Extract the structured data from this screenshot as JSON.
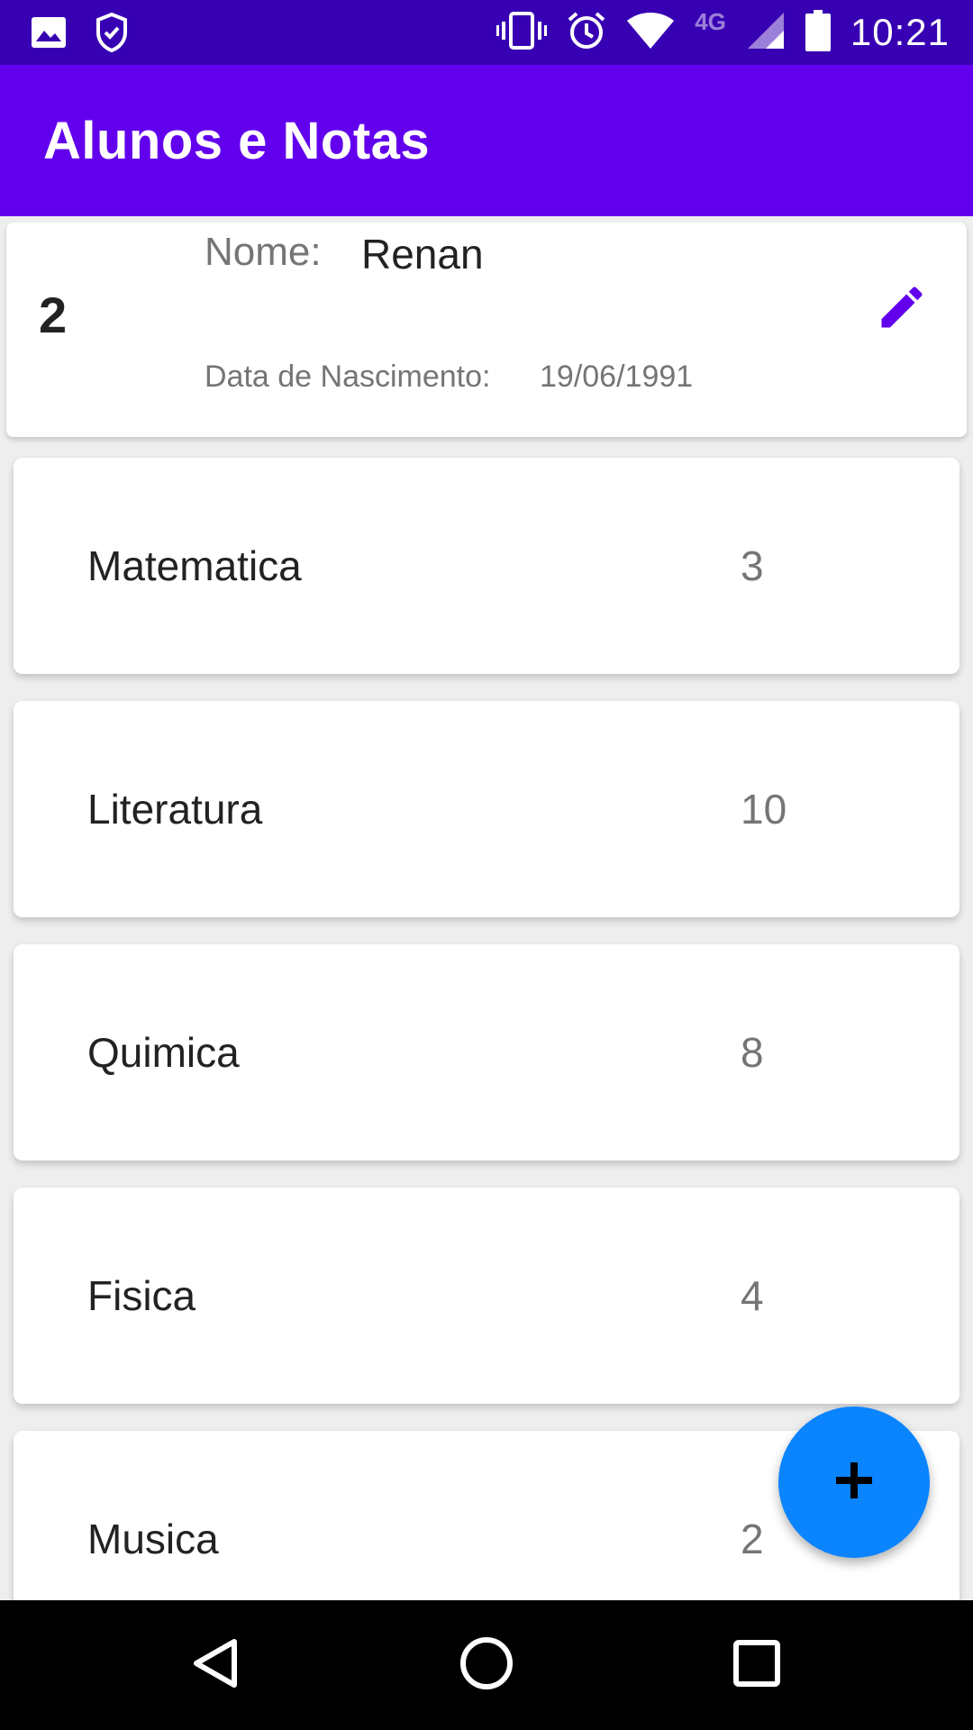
{
  "status_bar": {
    "time": "10:21",
    "network_label": "4G",
    "icons": [
      "image-icon",
      "shield-check-icon",
      "vibrate-icon",
      "alarm-icon",
      "wifi-icon",
      "signal-icon",
      "battery-icon"
    ]
  },
  "app_bar": {
    "title": "Alunos e Notas",
    "color": "#6200ee"
  },
  "student": {
    "id": "2",
    "name_label": "Nome:",
    "name": "Renan",
    "dob_label": "Data de Nascimento:",
    "dob": "19/06/1991",
    "edit_icon": "pencil-icon"
  },
  "grades": [
    {
      "subject": "Matematica",
      "grade": "3"
    },
    {
      "subject": "Literatura",
      "grade": "10"
    },
    {
      "subject": "Quimica",
      "grade": "8"
    },
    {
      "subject": "Fisica",
      "grade": "4"
    },
    {
      "subject": "Musica",
      "grade": "2"
    }
  ],
  "fab": {
    "icon": "plus-icon",
    "color": "#0a84ff"
  },
  "nav_bar": {
    "icons": [
      "back-icon",
      "home-icon",
      "recents-icon"
    ]
  }
}
